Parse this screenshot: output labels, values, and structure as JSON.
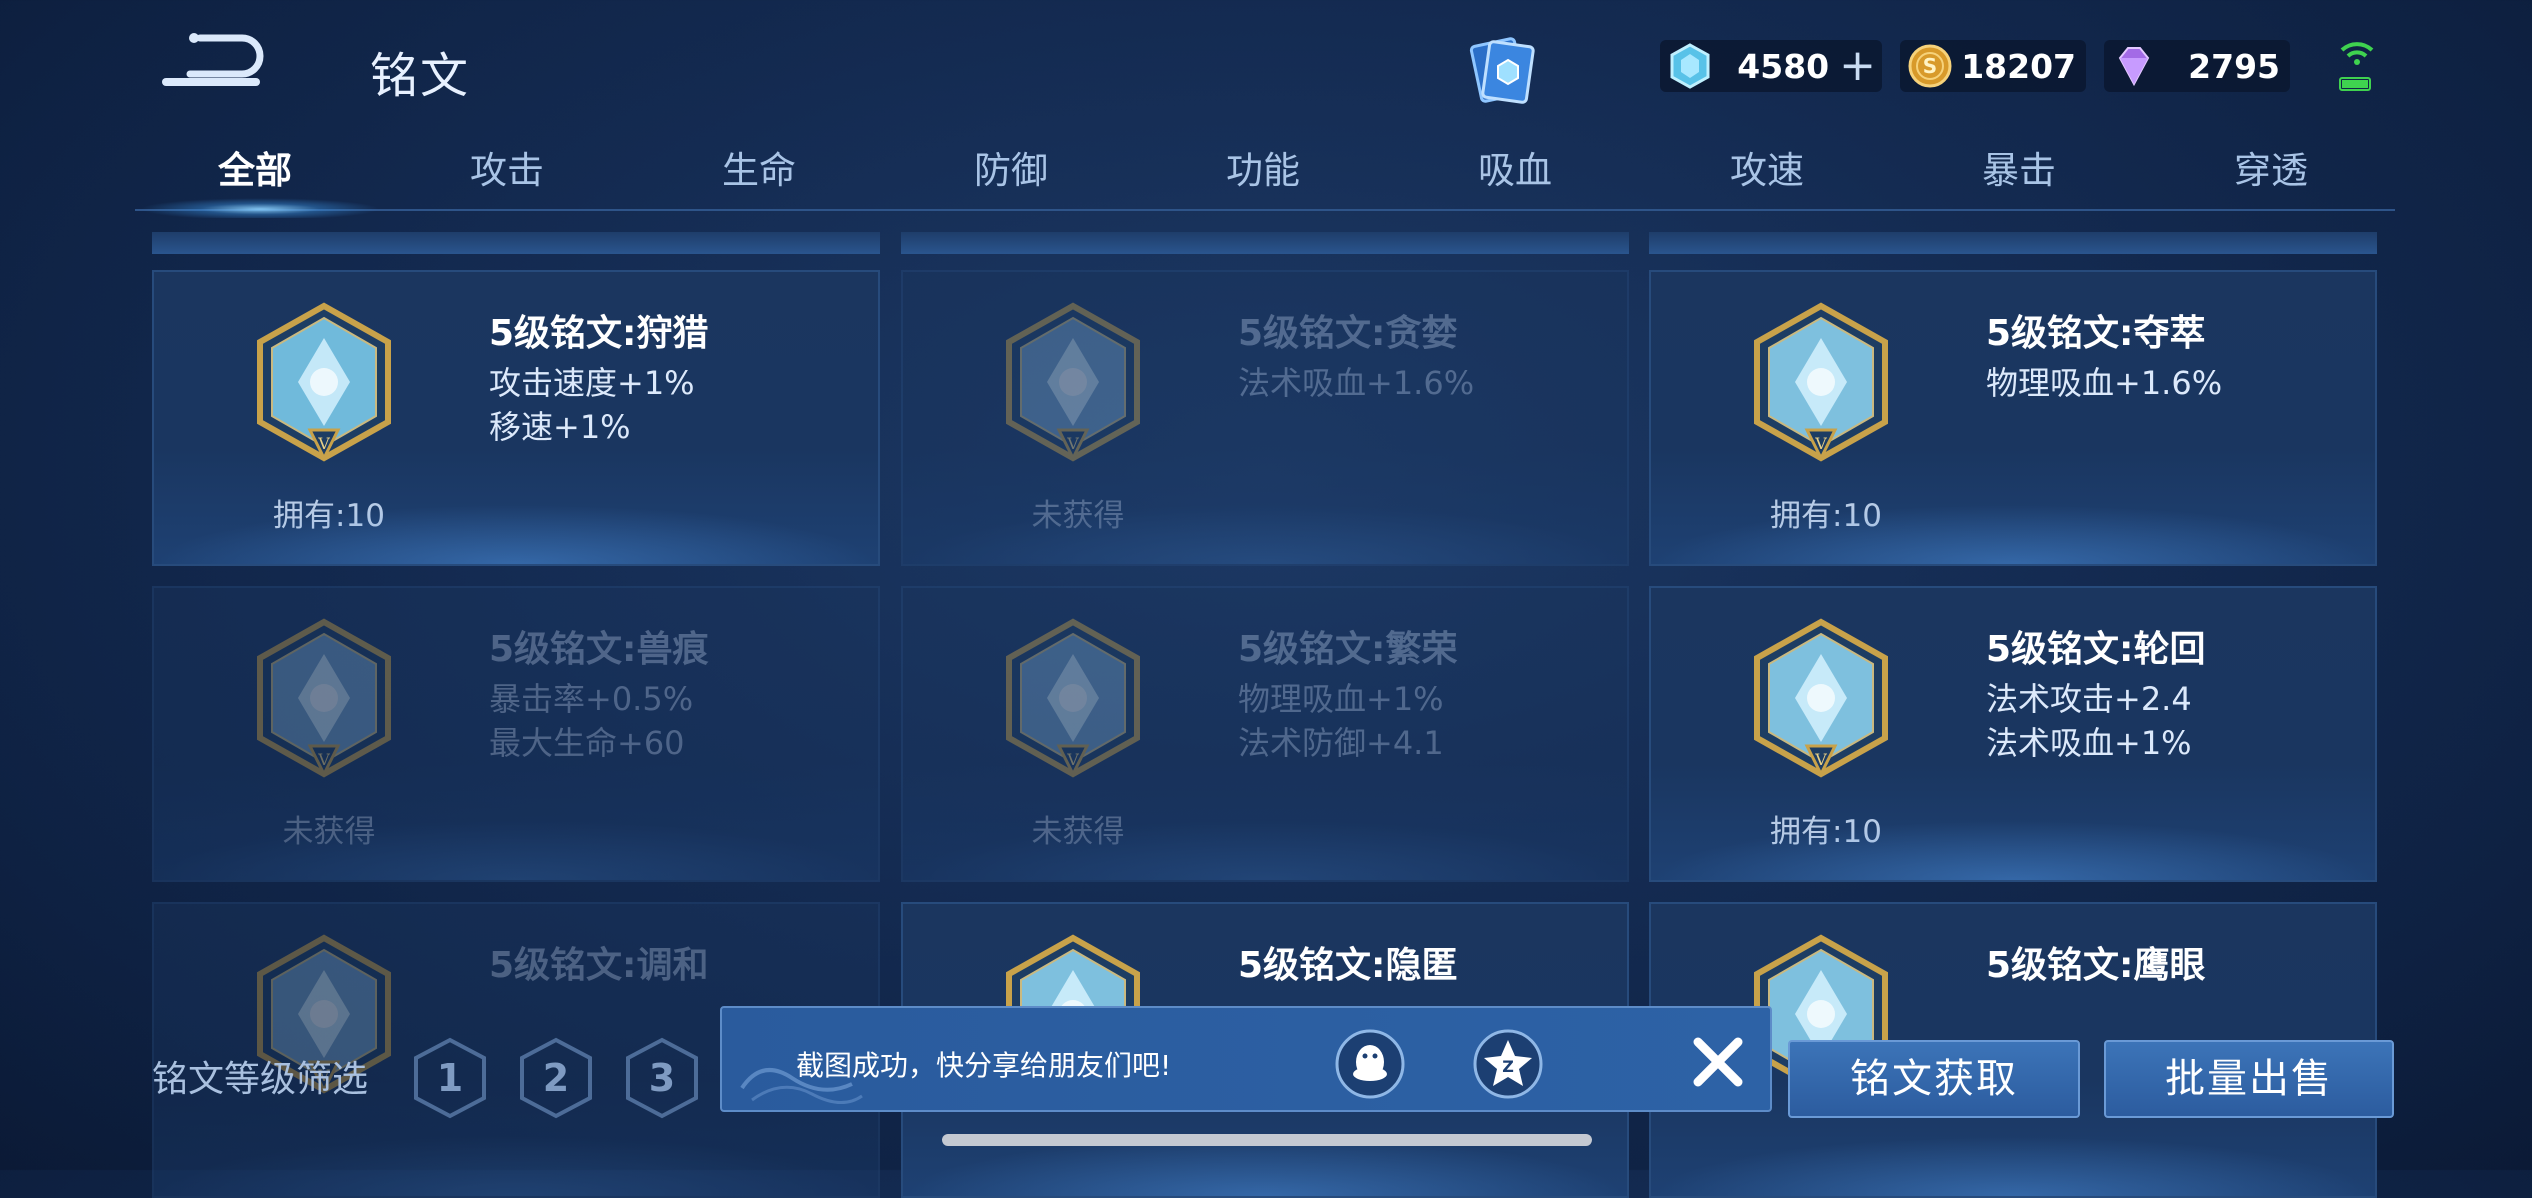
{
  "header": {
    "title": "铭文"
  },
  "currencies": {
    "gem": "4580",
    "coin": "18207",
    "diamond": "2795"
  },
  "tabs": [
    "全部",
    "攻击",
    "生命",
    "防御",
    "功能",
    "吸血",
    "攻速",
    "暴击",
    "穿透"
  ],
  "active_tab": "全部",
  "runes": [
    {
      "name": "5级铭文:狩猎",
      "stats": [
        "攻击速度+1%",
        "移速+1%"
      ],
      "owned": "拥有:10",
      "locked": false,
      "color": "#7fd0f0"
    },
    {
      "name": "5级铭文:贪婪",
      "stats": [
        "法术吸血+1.6%"
      ],
      "owned": "未获得",
      "locked": true,
      "color": "#7fb0d8"
    },
    {
      "name": "5级铭文:夺萃",
      "stats": [
        "物理吸血+1.6%"
      ],
      "owned": "拥有:10",
      "locked": false,
      "color": "#8fd8f4"
    },
    {
      "name": "5级铭文:兽痕",
      "stats": [
        "暴击率+0.5%",
        "最大生命+60"
      ],
      "owned": "未获得",
      "locked": true,
      "color": "#7fb0d8"
    },
    {
      "name": "5级铭文:繁荣",
      "stats": [
        "物理吸血+1%",
        "法术防御+4.1"
      ],
      "owned": "未获得",
      "locked": true,
      "color": "#7fb0d8"
    },
    {
      "name": "5级铭文:轮回",
      "stats": [
        "法术攻击+2.4",
        "法术吸血+1%"
      ],
      "owned": "拥有:10",
      "locked": false,
      "color": "#8fd8f4"
    },
    {
      "name": "5级铭文:调和",
      "stats": [],
      "owned": "",
      "locked": true,
      "color": "#7fb0d8"
    },
    {
      "name": "5级铭文:隐匿",
      "stats": [],
      "owned": "",
      "locked": false,
      "color": "#8fd8f4"
    },
    {
      "name": "5级铭文:鹰眼",
      "stats": [],
      "owned": "",
      "locked": false,
      "color": "#8fd8f4"
    }
  ],
  "filter": {
    "label": "铭文等级筛选",
    "levels": [
      "1",
      "2",
      "3"
    ]
  },
  "toast": {
    "message": "截图成功，快分享给朋友们吧!"
  },
  "buttons": {
    "acquire": "铭文获取",
    "sell": "批量出售"
  }
}
